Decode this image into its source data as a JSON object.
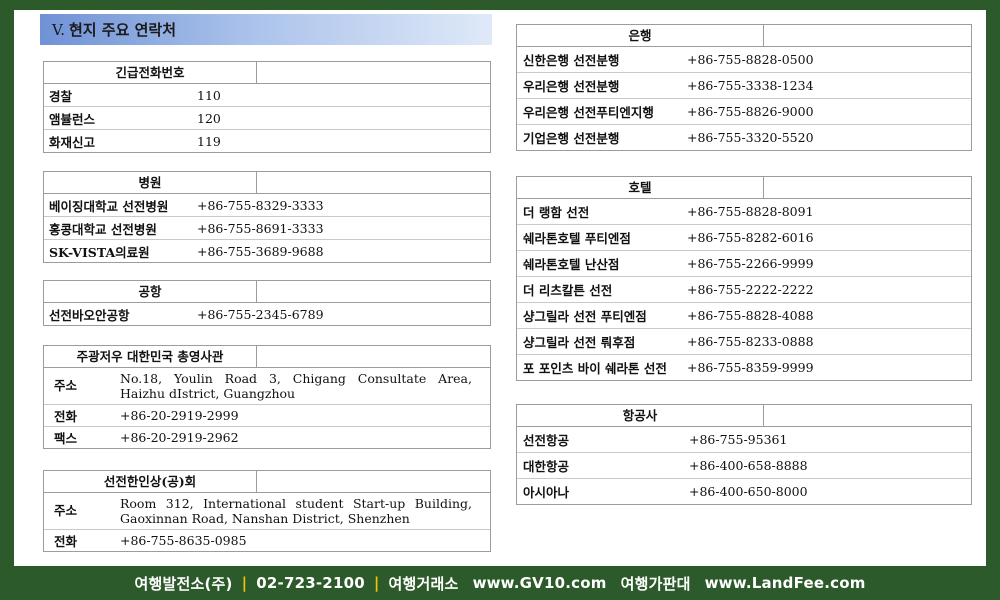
{
  "section": {
    "number": "V.",
    "title": "현지 주요 연락처"
  },
  "emergency": {
    "title": "긴급전화번호",
    "rows": [
      {
        "name": "경찰",
        "value": "110"
      },
      {
        "name": "앰뷸런스",
        "value": "120"
      },
      {
        "name": "화재신고",
        "value": "119"
      }
    ]
  },
  "hospital": {
    "title": "병원",
    "rows": [
      {
        "name": "베이징대학교 선전병원",
        "value": "+86-755-8329-3333"
      },
      {
        "name": "홍콩대학교 선전병원",
        "value": "+86-755-8691-3333"
      },
      {
        "name": "SK-VISTA의료원",
        "value": "+86-755-3689-9688"
      }
    ]
  },
  "airport": {
    "title": "공항",
    "rows": [
      {
        "name": "선전바오안공항",
        "value": "+86-755-2345-6789"
      }
    ]
  },
  "consulate": {
    "title": "주광저우 대한민국 총영사관",
    "address_label": "주소",
    "address_lines": [
      "No.18, Youlin Road 3, Chigang Consultate Area,",
      "Haizhu dIstrict, Guangzhou"
    ],
    "phone_label": "전화",
    "phone": "+86-20-2919-2999",
    "fax_label": "팩스",
    "fax": "+86-20-2919-2962"
  },
  "association": {
    "title": "선전한인상(공)회",
    "address_label": "주소",
    "address_lines": [
      "Room 312, International student Start-up Building,",
      "Gaoxinnan Road, Nanshan District, Shenzhen"
    ],
    "phone_label": "전화",
    "phone": "+86-755-8635-0985"
  },
  "banks": {
    "title": "은행",
    "rows": [
      {
        "name": "신한은행 선전분행",
        "value": "+86-755-8828-0500"
      },
      {
        "name": "우리은행 선전분행",
        "value": "+86-755-3338-1234"
      },
      {
        "name": "우리은행 선전푸티엔지행",
        "value": "+86-755-8826-9000"
      },
      {
        "name": "기업은행 선전분행",
        "value": "+86-755-3320-5520"
      }
    ]
  },
  "hotels": {
    "title": "호텔",
    "rows": [
      {
        "name": "더 랭함 선전",
        "value": "+86-755-8828-8091"
      },
      {
        "name": "쉐라톤호텔 푸티엔점",
        "value": "+86-755-8282-6016"
      },
      {
        "name": "쉐라톤호텔 난산점",
        "value": "+86-755-2266-9999"
      },
      {
        "name": "더 리츠칼튼 선전",
        "value": "+86-755-2222-2222"
      },
      {
        "name": "샹그릴라 선전 푸티엔점",
        "value": "+86-755-8828-4088"
      },
      {
        "name": "샹그릴라 선전 뤄후점",
        "value": "+86-755-8233-0888"
      },
      {
        "name": "포 포인츠 바이 쉐라톤 선전",
        "value": "+86-755-8359-9999"
      }
    ]
  },
  "airlines": {
    "title": "항공사",
    "rows": [
      {
        "name": "선전항공",
        "value": "+86-755-95361"
      },
      {
        "name": "대한항공",
        "value": "+86-400-658-8888"
      },
      {
        "name": "아시아나",
        "value": "+86-400-650-8000"
      }
    ]
  },
  "footer": {
    "company": "여행발전소(주)",
    "phone": "02-723-2100",
    "label1": "여행거래소",
    "url1": "www.GV10.com",
    "label2": "여행가판대",
    "url2": "www.LandFee.com",
    "separator": "|"
  }
}
